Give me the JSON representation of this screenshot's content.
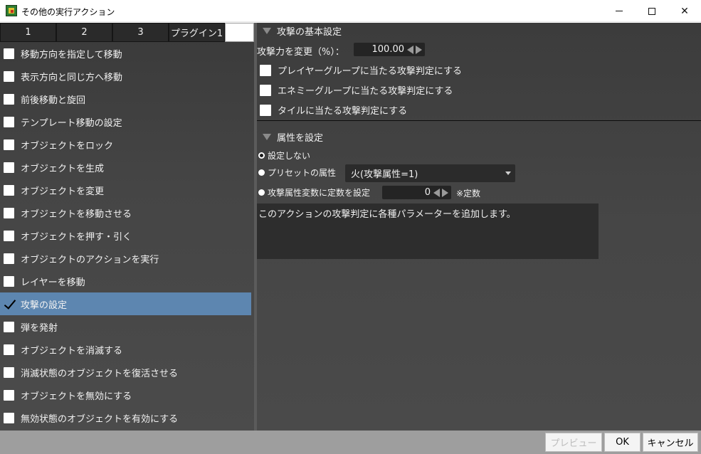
{
  "window": {
    "title": "その他の実行アクション",
    "controls": {
      "minimize": "—",
      "maximize": "□",
      "close": "✕"
    }
  },
  "tabs": [
    "1",
    "2",
    "3",
    "プラグイン1"
  ],
  "actions": [
    {
      "label": "移動方向を指定して移動",
      "checked": false
    },
    {
      "label": "表示方向と同じ方へ移動",
      "checked": false
    },
    {
      "label": "前後移動と旋回",
      "checked": false
    },
    {
      "label": "テンプレート移動の設定",
      "checked": false
    },
    {
      "label": "オブジェクトをロック",
      "checked": false
    },
    {
      "label": "オブジェクトを生成",
      "checked": false
    },
    {
      "label": "オブジェクトを変更",
      "checked": false
    },
    {
      "label": "オブジェクトを移動させる",
      "checked": false
    },
    {
      "label": "オブジェクトを押す・引く",
      "checked": false
    },
    {
      "label": "オブジェクトのアクションを実行",
      "checked": false
    },
    {
      "label": "レイヤーを移動",
      "checked": false
    },
    {
      "label": "攻撃の設定",
      "checked": true
    },
    {
      "label": "弾を発射",
      "checked": false
    },
    {
      "label": "オブジェクトを消滅する",
      "checked": false
    },
    {
      "label": "消滅状態のオブジェクトを復活させる",
      "checked": false
    },
    {
      "label": "オブジェクトを無効にする",
      "checked": false
    },
    {
      "label": "無効状態のオブジェクトを有効にする",
      "checked": false
    }
  ],
  "attack_basic": {
    "header": "攻撃の基本設定",
    "power_label": "攻撃力を変更（%）：",
    "power_value": "100.00",
    "player_group": "プレイヤーグループに当たる攻撃判定にする",
    "enemy_group": "エネミーグループに当たる攻撃判定にする",
    "tile": "タイルに当たる攻撃判定にする"
  },
  "attribute": {
    "header": "属性を設定",
    "no_setting": "設定しない",
    "preset_label": "プリセットの属性",
    "preset_value": "火(攻撃属性=1)",
    "variable_label": "攻撃属性変数に定数を設定",
    "variable_value": "0",
    "constant_note": "※定数",
    "selected": "no_setting"
  },
  "description": "このアクションの攻撃判定に各種パラメーターを追加します。",
  "footer": {
    "preview": "プレビュー",
    "ok": "OK",
    "cancel": "キャンセル"
  }
}
